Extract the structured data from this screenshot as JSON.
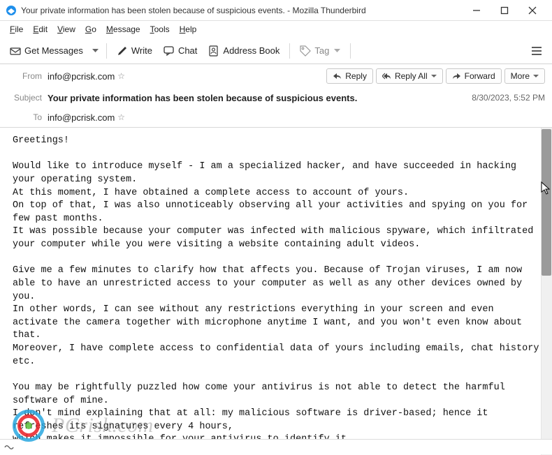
{
  "window": {
    "title": "Your private information has been stolen because of suspicious events. - Mozilla Thunderbird"
  },
  "menubar": {
    "file": "File",
    "edit": "Edit",
    "view": "View",
    "go": "Go",
    "message": "Message",
    "tools": "Tools",
    "help": "Help"
  },
  "toolbar": {
    "get_messages": "Get Messages",
    "write": "Write",
    "chat": "Chat",
    "address_book": "Address Book",
    "tag": "Tag"
  },
  "header": {
    "from_label": "From",
    "from_value": "info@pcrisk.com",
    "subject_label": "Subject",
    "subject_value": "Your private information has been stolen because of suspicious events.",
    "to_label": "To",
    "to_value": "info@pcrisk.com",
    "date": "8/30/2023, 5:52 PM",
    "reply": "Reply",
    "reply_all": "Reply All",
    "forward": "Forward",
    "more": "More"
  },
  "body": "Greetings!\n\nWould like to introduce myself - I am a specialized hacker, and have succeeded in hacking your operating system.\nAt this moment, I have obtained a complete access to account of yours.\nOn top of that, I was also unnoticeably observing all your activities and spying on you for few past months.\nIt was possible because your computer was infected with malicious spyware, which infiltrated your computer while you were visiting a website containing adult videos.\n\nGive me a few minutes to clarify how that affects you. Because of Trojan viruses, I am now able to have an unrestricted access to your computer as well as any other devices owned by you.\nIn other words, I can see without any restrictions everything in your screen and even activate the camera together with microphone anytime I want, and you won't even know about that.\nMoreover, I have complete access to confidential data of yours including emails, chat history etc.\n\nYou may be rightfully puzzled how come your antivirus is not able to detect the harmful software of mine.\nI don't mind explaining that at all: my malicious software is driver-based; hence it refreshes its signatures every 4 hours,\nwhich makes it impossible for your antivirus to identify it.",
  "watermark": {
    "text": "PCrisk.com"
  }
}
